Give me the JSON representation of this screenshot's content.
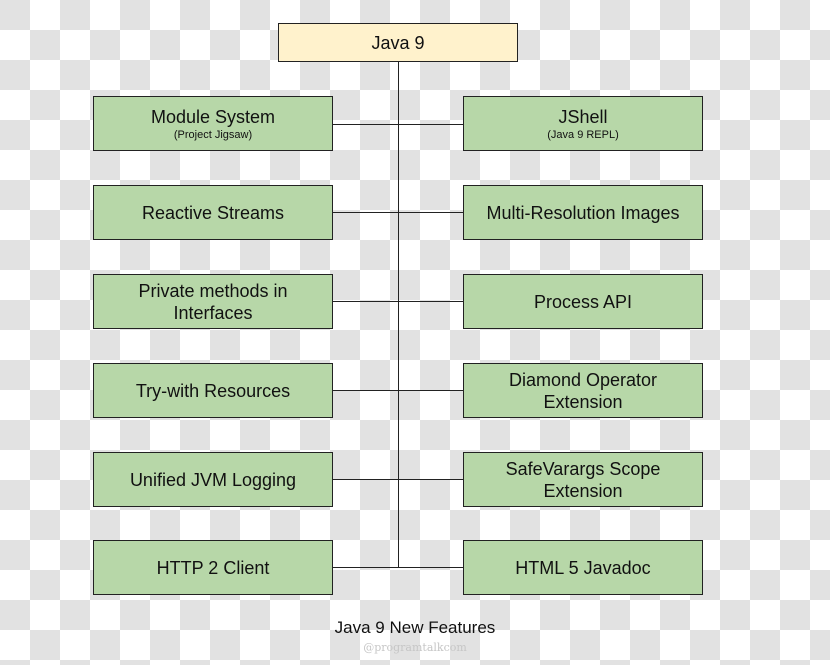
{
  "diagram": {
    "root": {
      "label": "Java 9"
    },
    "left_nodes": [
      {
        "label": "Module System",
        "sub": "(Project Jigsaw)"
      },
      {
        "label": "Reactive Streams",
        "sub": ""
      },
      {
        "label": "Private methods in Interfaces",
        "sub": ""
      },
      {
        "label": "Try-with Resources",
        "sub": ""
      },
      {
        "label": "Unified JVM Logging",
        "sub": ""
      },
      {
        "label": "HTTP 2 Client",
        "sub": ""
      }
    ],
    "right_nodes": [
      {
        "label": "JShell",
        "sub": "(Java 9 REPL)"
      },
      {
        "label": "Multi-Resolution Images",
        "sub": ""
      },
      {
        "label": "Process API",
        "sub": ""
      },
      {
        "label": "Diamond Operator Extension",
        "sub": ""
      },
      {
        "label": "SafeVarargs Scope Extension",
        "sub": ""
      },
      {
        "label": "HTML 5 Javadoc",
        "sub": ""
      }
    ],
    "colors": {
      "root_fill": "#fff2cc",
      "node_fill": "#b7d7a8",
      "stroke": "#222222"
    }
  },
  "caption": {
    "title": "Java 9 New Features",
    "watermark": "@programtalkcom"
  }
}
